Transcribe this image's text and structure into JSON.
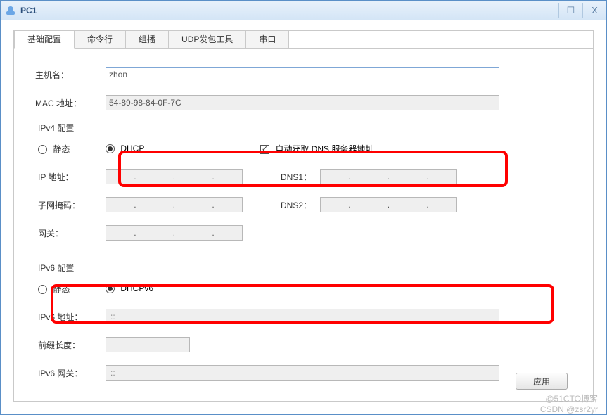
{
  "window": {
    "title": "PC1"
  },
  "tabs": {
    "items": [
      "基础配置",
      "命令行",
      "组播",
      "UDP发包工具",
      "串口"
    ],
    "active": 0
  },
  "basic": {
    "hostname_label": "主机名：",
    "hostname_value": "zhon",
    "mac_label": "MAC 地址：",
    "mac_value": "54-89-98-84-0F-7C"
  },
  "ipv4": {
    "group_title": "IPv4 配置",
    "static_label": "静态",
    "dhcp_label": "DHCP",
    "auto_dns_label": "自动获取 DNS 服务器地址",
    "selected": "dhcp",
    "auto_dns_checked": true,
    "ip_label": "IP 地址：",
    "mask_label": "子网掩码：",
    "gw_label": "网关：",
    "dns1_label": "DNS1：",
    "dns2_label": "DNS2："
  },
  "ipv6": {
    "group_title": "IPv6 配置",
    "static_label": "静态",
    "dhcp_label": "DHCPv6",
    "selected": "dhcpv6",
    "addr_label": "IPv6 地址：",
    "prefix_label": "前缀长度：",
    "gw_label": "IPv6 网关："
  },
  "footer": {
    "apply_label": "应用"
  },
  "watermark": {
    "line1": "@51CTO博客",
    "line2": "CSDN @zsr2yr"
  }
}
